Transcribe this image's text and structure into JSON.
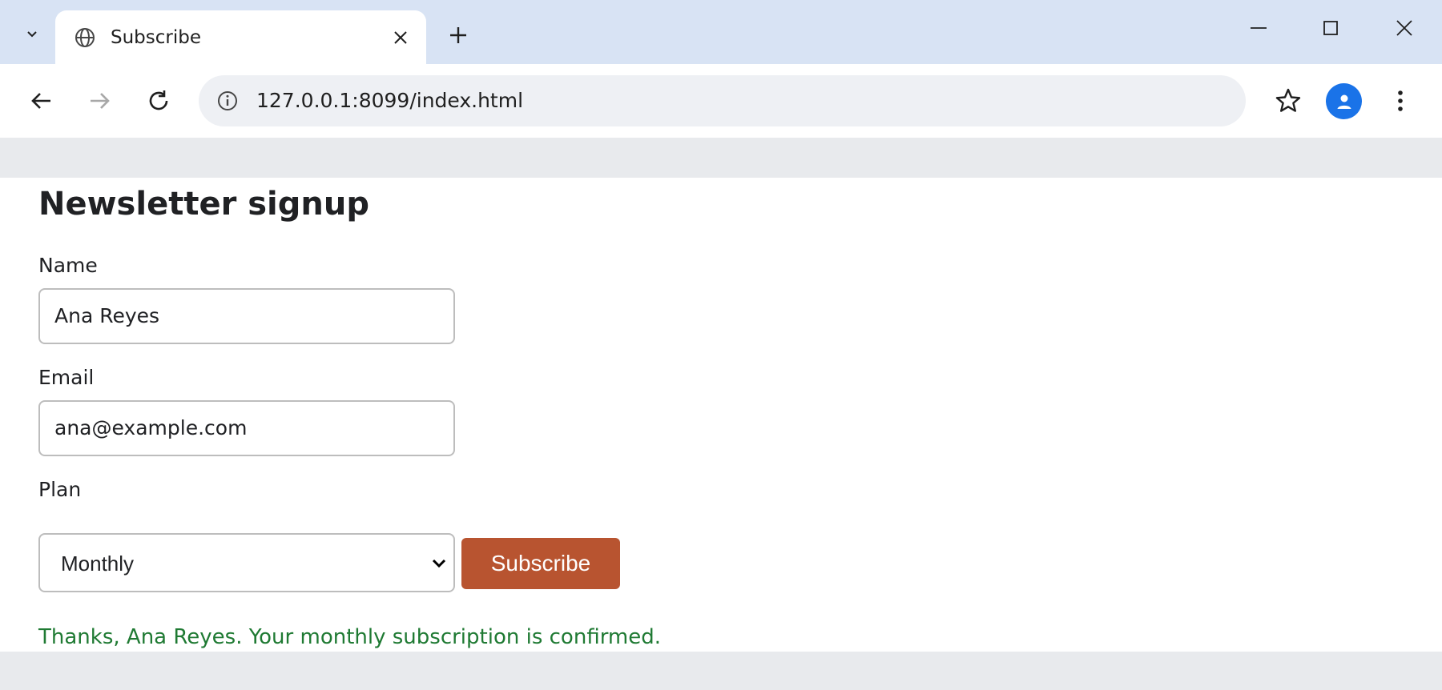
{
  "browser": {
    "tab": {
      "title": "Subscribe"
    },
    "address_bar": {
      "url": "127.0.0.1:8099/index.html"
    },
    "colors": {
      "tabstrip": "#d8e3f4",
      "toolbar": "#ffffff",
      "omnibox": "#eef0f4",
      "avatar": "#1a73e8"
    }
  },
  "page": {
    "heading": "Newsletter signup",
    "form": {
      "name_label": "Name",
      "name_value": "Ana Reyes",
      "email_label": "Email",
      "email_value": "ana@example.com",
      "plan_label": "Plan",
      "plan_selected": "Monthly",
      "submit_label": "Subscribe"
    },
    "confirmation": "Thanks, Ana Reyes. Your monthly subscription is confirmed.",
    "colors": {
      "button": "#b85430",
      "confirmation_text": "#1f7a33"
    }
  }
}
